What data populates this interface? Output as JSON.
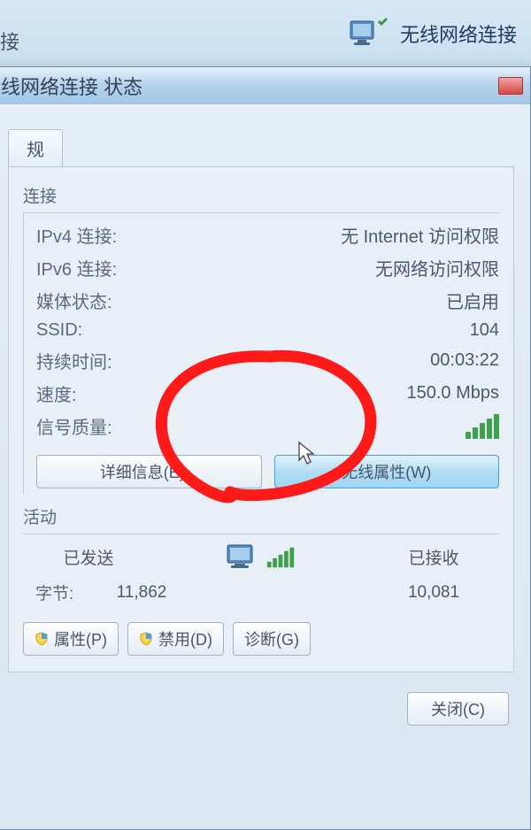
{
  "bg": {
    "left_label": "接",
    "right_label": "无线网络连接"
  },
  "dialog": {
    "title": "线网络连接 状态",
    "tab_general": "规"
  },
  "conn": {
    "group_label": "连接",
    "ipv4_label": "IPv4 连接:",
    "ipv4_value": "无 Internet 访问权限",
    "ipv6_label": "IPv6 连接:",
    "ipv6_value": "无网络访问权限",
    "media_label": "媒体状态:",
    "media_value": "已启用",
    "ssid_label": "SSID:",
    "ssid_value": "104",
    "duration_label": "持续时间:",
    "duration_value": "00:03:22",
    "speed_label": "速度:",
    "speed_value": "150.0 Mbps",
    "signal_label": "信号质量:"
  },
  "buttons": {
    "details": "详细信息(E)...",
    "wireless_props": "无线属性(W)",
    "properties": "属性(P)",
    "disable": "禁用(D)",
    "diagnose": "诊断(G)",
    "close": "关闭(C)"
  },
  "activity": {
    "group_label": "活动",
    "sent": "已发送",
    "received": "已接收",
    "bytes_label": "字节:",
    "sent_value": "11,862",
    "received_value": "10,081"
  }
}
